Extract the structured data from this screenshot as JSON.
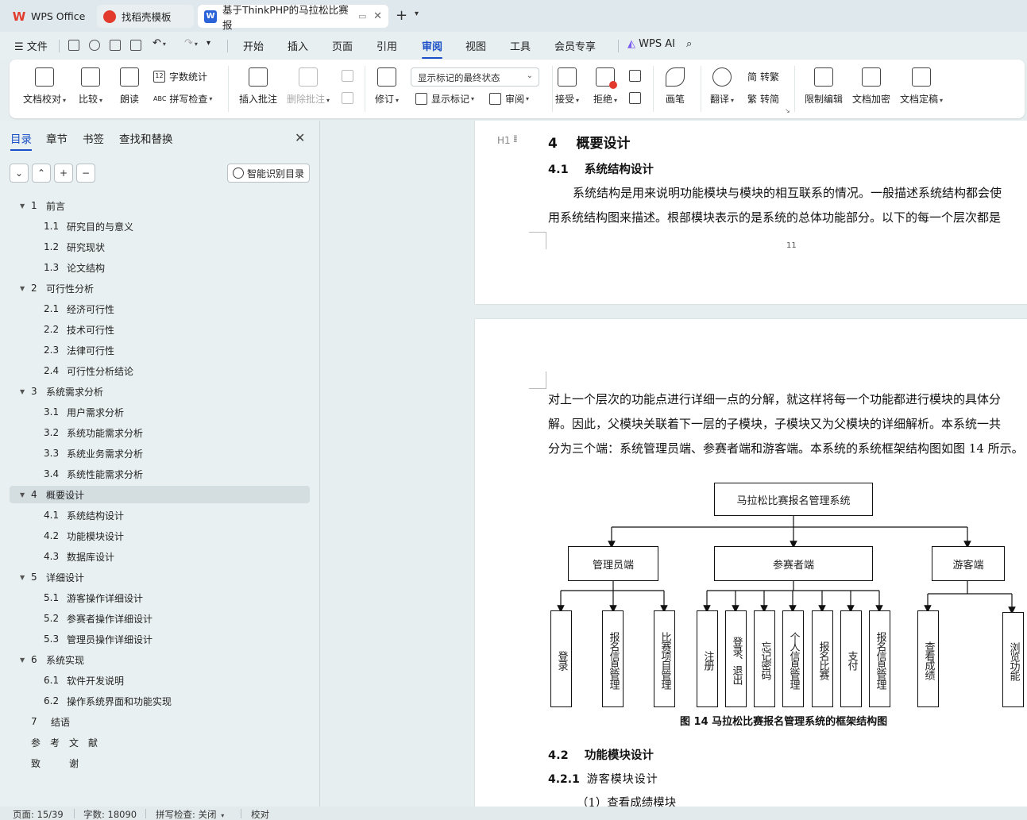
{
  "tabs": [
    {
      "label": "WPS Office",
      "icon": "wps-logo-icon"
    },
    {
      "label": "找稻壳模板",
      "icon": "docer-icon"
    },
    {
      "label": "基于ThinkPHP的马拉松比赛报",
      "icon": "word-doc-icon",
      "icon_text": "W"
    }
  ],
  "menu": {
    "file": "文件",
    "items": [
      "开始",
      "插入",
      "页面",
      "引用",
      "审阅",
      "视图",
      "工具",
      "会员专享"
    ],
    "active": "审阅",
    "ai": "WPS AI"
  },
  "ribbon": {
    "doc_proofread": "文档校对",
    "compare": "比较",
    "read_aloud": "朗读",
    "word_count": "字数统计",
    "spell_check": "拼写检查",
    "insert_comment": "插入批注",
    "delete_comment": "删除批注",
    "track_changes": "修订",
    "markup_state": "显示标记的最终状态",
    "show_markup": "显示标记",
    "review": "审阅",
    "accept": "接受",
    "reject": "拒绝",
    "pen": "画笔",
    "translate": "翻译",
    "to_traditional": "转繁",
    "to_simplified": "转简",
    "restrict_edit": "限制编辑",
    "encrypt": "文档加密",
    "finalize": "文档定稿",
    "abc": "ABC",
    "num12": "12",
    "simp_char": "简",
    "trad_char": "繁"
  },
  "nav": {
    "tabs": [
      "目录",
      "章节",
      "书签",
      "查找和替换"
    ],
    "smart_toc": "智能识别目录",
    "toc": [
      {
        "num": "1",
        "title": "前言",
        "level": 1
      },
      {
        "num": "1.1",
        "title": "研究目的与意义",
        "level": 2
      },
      {
        "num": "1.2",
        "title": "研究现状",
        "level": 2
      },
      {
        "num": "1.3",
        "title": "论文结构",
        "level": 2
      },
      {
        "num": "2",
        "title": "可行性分析",
        "level": 1
      },
      {
        "num": "2.1",
        "title": "经济可行性",
        "level": 2
      },
      {
        "num": "2.2",
        "title": "技术可行性",
        "level": 2
      },
      {
        "num": "2.3",
        "title": "法律可行性",
        "level": 2
      },
      {
        "num": "2.4",
        "title": "可行性分析结论",
        "level": 2
      },
      {
        "num": "3",
        "title": "系统需求分析",
        "level": 1
      },
      {
        "num": "3.1",
        "title": "用户需求分析",
        "level": 2
      },
      {
        "num": "3.2",
        "title": "系统功能需求分析",
        "level": 2
      },
      {
        "num": "3.3",
        "title": "系统业务需求分析",
        "level": 2
      },
      {
        "num": "3.4",
        "title": "系统性能需求分析",
        "level": 2
      },
      {
        "num": "4",
        "title": "概要设计",
        "level": 1
      },
      {
        "num": "4.1",
        "title": "系统结构设计",
        "level": 2
      },
      {
        "num": "4.2",
        "title": "功能模块设计",
        "level": 2
      },
      {
        "num": "4.3",
        "title": "数据库设计",
        "level": 2
      },
      {
        "num": "5",
        "title": "详细设计",
        "level": 1
      },
      {
        "num": "5.1",
        "title": "游客操作详细设计",
        "level": 2
      },
      {
        "num": "5.2",
        "title": "参赛者操作详细设计",
        "level": 2
      },
      {
        "num": "5.3",
        "title": "管理员操作详细设计",
        "level": 2
      },
      {
        "num": "6",
        "title": "系统实现",
        "level": 1
      },
      {
        "num": "6.1",
        "title": "软件开发说明",
        "level": 2
      },
      {
        "num": "6.2",
        "title": "操作系统界面和功能实现",
        "level": 2
      },
      {
        "num": "7",
        "title": "结语",
        "level": 0
      },
      {
        "num": "",
        "title": "参　考　文　献",
        "level": 0
      },
      {
        "num": "",
        "title": "致　　　谢",
        "level": 0
      }
    ],
    "active_index": 14
  },
  "document": {
    "heading_marker": "H1",
    "h1_num": "4",
    "h1_title": "概要设计",
    "h2a_num": "4.1",
    "h2a_title": "系统结构设计",
    "para1_line1": "系统结构是用来说明功能模块与模块的相互联系的情况。一般描述系统结构都会使",
    "para1_line2": "用系统结构图来描述。根部模块表示的是系统的总体功能部分。以下的每一个层次都是",
    "page_number": "11",
    "para2_line1": "对上一个层次的功能点进行详细一点的分解，就这样将每一个功能都进行模块的具体分",
    "para2_line2": "解。因此，父模块关联着下一层的子模块，子模块又为父模块的详细解析。本系统一共",
    "para2_line3": "分为三个端：系统管理员端、参赛者端和游客端。本系统的系统框架结构图如图 14 所示。",
    "figure_caption": "图 14  马拉松比赛报名管理系统的框架结构图",
    "h2b_num": "4.2",
    "h2b_title": "功能模块设计",
    "h3_num": "4.2.1",
    "h3_title": "游客模块设计",
    "item1": "（1）查看成绩模块"
  },
  "diagram": {
    "root": "马拉松比赛报名管理系统",
    "admin": "管理员端",
    "participant": "参赛者端",
    "visitor": "游客端",
    "admin_children": [
      "登录",
      "报名信息管理",
      "比赛项目管理"
    ],
    "participant_children": [
      "注册",
      "登录、退出",
      "忘记密码",
      "个人信息管理",
      "报名比赛",
      "支付",
      "报名信息管理"
    ],
    "visitor_children": [
      "查看成绩",
      "浏览功能"
    ]
  },
  "status": {
    "page": "页面: 15/39",
    "words": "字数: 18090",
    "spell": "拼写检查: 关闭",
    "proof": "校对"
  },
  "colors": {
    "accent": "#1a4fc7",
    "wps_red": "#e23b2e"
  }
}
